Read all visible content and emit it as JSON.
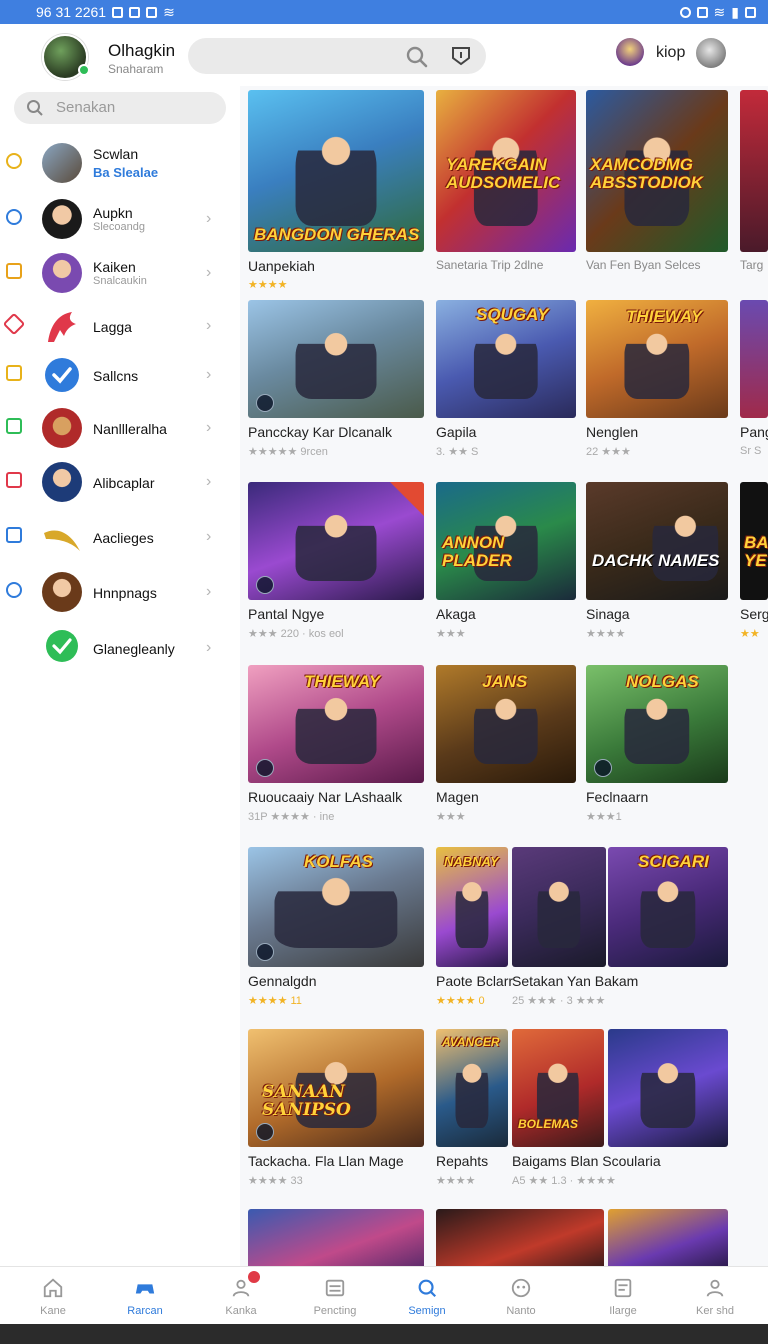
{
  "status_bar": {
    "time": "96 31 2261"
  },
  "header": {
    "profile_name": "Olhagkin",
    "profile_sub": "Snaharam",
    "user_name": "kiop"
  },
  "sidebar": {
    "search_placeholder": "Senakan",
    "items": [
      {
        "title": "Scwlan",
        "sub": "Ba Slealae",
        "icon": "crown-icon",
        "color": "#e8b21a"
      },
      {
        "title": "Aupkn",
        "sub": "Slecoandg",
        "icon": "clock-icon",
        "color": "#2f7bdb"
      },
      {
        "title": "Kaiken",
        "sub": "Snalcaukin",
        "icon": "square-icon",
        "color": "#e8a21a"
      },
      {
        "title": "Lagga",
        "sub": "",
        "icon": "gear-icon",
        "color": "#e0384a"
      },
      {
        "title": "Sallcns",
        "sub": "",
        "icon": "square-icon",
        "color": "#e8b21a"
      },
      {
        "title": "Nanllleralha",
        "sub": "",
        "icon": "square-icon",
        "color": "#2ebd57"
      },
      {
        "title": "Alibcaplar",
        "sub": "",
        "icon": "square-icon",
        "color": "#e0384a"
      },
      {
        "title": "Aaclieges",
        "sub": "",
        "icon": "square-icon",
        "color": "#2f7bdb"
      },
      {
        "title": "Hnnpnags",
        "sub": "",
        "icon": "flower-icon",
        "color": "#2f7bdb"
      },
      {
        "title": "Glanegleanly",
        "sub": "",
        "icon": "",
        "color": ""
      }
    ]
  },
  "games": [
    {
      "title": "Uanpekiah",
      "meta": "★★★★",
      "thumb_text": "Bangdon Gheras"
    },
    {
      "title": "Sanetaria Trip 2dlne",
      "meta": "",
      "thumb_text": "Yarekgain Audsomelic"
    },
    {
      "title": "Van Fen Byan Selces",
      "meta": "",
      "thumb_text": "Xamcodmg Absstodiok"
    },
    {
      "title": "Targ",
      "meta": "",
      "thumb_text": ""
    },
    {
      "title": "Pancckay Kar Dlcanalk",
      "meta": "★★★★★ 9rcen",
      "thumb_text": ""
    },
    {
      "title": "Gapila",
      "meta": "3. ★★ S",
      "thumb_text": "Squgay"
    },
    {
      "title": "Nenglen",
      "meta": "22 ★★★",
      "thumb_text": "Thieway"
    },
    {
      "title": "Pang",
      "meta": "Sr S",
      "thumb_text": ""
    },
    {
      "title": "Pantal Ngye",
      "meta": "★★★ 220 · kos eol",
      "thumb_text": ""
    },
    {
      "title": "Akaga",
      "meta": "★★★",
      "thumb_text": "Annon Plader"
    },
    {
      "title": "Sinaga",
      "meta": "★★★★",
      "thumb_text": "Dachk Names"
    },
    {
      "title": "Serg",
      "meta": "★★",
      "thumb_text": "Ba Ye"
    },
    {
      "title": "Ruoucaaiy Nar LAshaalk",
      "meta": "31P ★★★★ · ine",
      "thumb_text": "Thieway"
    },
    {
      "title": "Magen",
      "meta": "★★★",
      "thumb_text": "Jans"
    },
    {
      "title": "Feclnaarn",
      "meta": "★★★1",
      "thumb_text": "Nolgas"
    },
    {
      "title": "Gennalgdn",
      "meta": "★★★★ 11",
      "thumb_text": "Kolfas"
    },
    {
      "title": "Paote Bclarr",
      "meta": "★★★★ 0",
      "thumb_text": "Nabnay"
    },
    {
      "title": "Setakan Yan Bakam",
      "meta": "25 ★★★ · 3 ★★★",
      "thumb_text": "Scigari"
    },
    {
      "title": "Tackacha. Fla Llan Mage",
      "meta": "★★★★ 33",
      "thumb_text": "Sanaan Sanipso"
    },
    {
      "title": "Repahts",
      "meta": "★★★★",
      "thumb_text": "Avancer"
    },
    {
      "title": "Baigams Blan Scoularia",
      "meta": "A5 ★★ 1.3 · ★★★★",
      "thumb_text": "Bolemas"
    },
    {
      "title": "",
      "meta": "",
      "thumb_text": ""
    },
    {
      "title": "",
      "meta": "",
      "thumb_text": ""
    },
    {
      "title": "",
      "meta": "",
      "thumb_text": ""
    }
  ],
  "bottom_nav": [
    {
      "label": "Kane",
      "icon": "home-icon"
    },
    {
      "label": "Rarcan",
      "icon": "gamepad-icon"
    },
    {
      "label": "Kanka",
      "icon": "users-icon"
    },
    {
      "label": "Pencting",
      "icon": "list-icon"
    },
    {
      "label": "Semign",
      "icon": "search-icon"
    },
    {
      "label": "Nanto",
      "icon": "grid-icon"
    },
    {
      "label": "Ilarge",
      "icon": "doc-icon"
    },
    {
      "label": "Ker shd",
      "icon": "person-icon"
    }
  ]
}
